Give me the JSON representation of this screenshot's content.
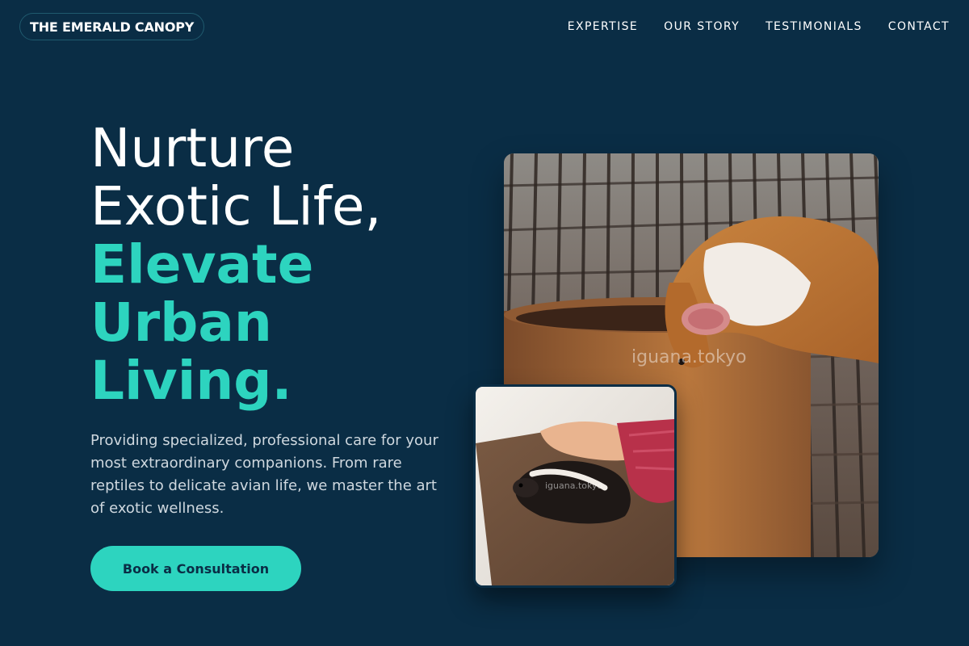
{
  "brand": {
    "name": "THE EMERALD CANOPY"
  },
  "nav": {
    "items": [
      {
        "label": "EXPERTISE"
      },
      {
        "label": "OUR STORY"
      },
      {
        "label": "TESTIMONIALS"
      },
      {
        "label": "CONTACT"
      }
    ]
  },
  "hero": {
    "title_line1": "Nurture",
    "title_line2": "Exotic Life,",
    "accent_line1": "Elevate",
    "accent_line2": "Urban",
    "accent_line3": "Living.",
    "description": "Providing specialized, professional care for your most extraordinary companions. From rare reptiles to delicate avian life, we master the art of exotic wellness.",
    "cta_label": "Book a Consultation"
  },
  "images": {
    "main_watermark": "iguana.tokyo",
    "secondary_watermark": "iguana.tokyo"
  },
  "colors": {
    "background": "#0a2d45",
    "accent": "#2dd4bf",
    "text": "#ffffff",
    "muted": "#cfd8df"
  }
}
